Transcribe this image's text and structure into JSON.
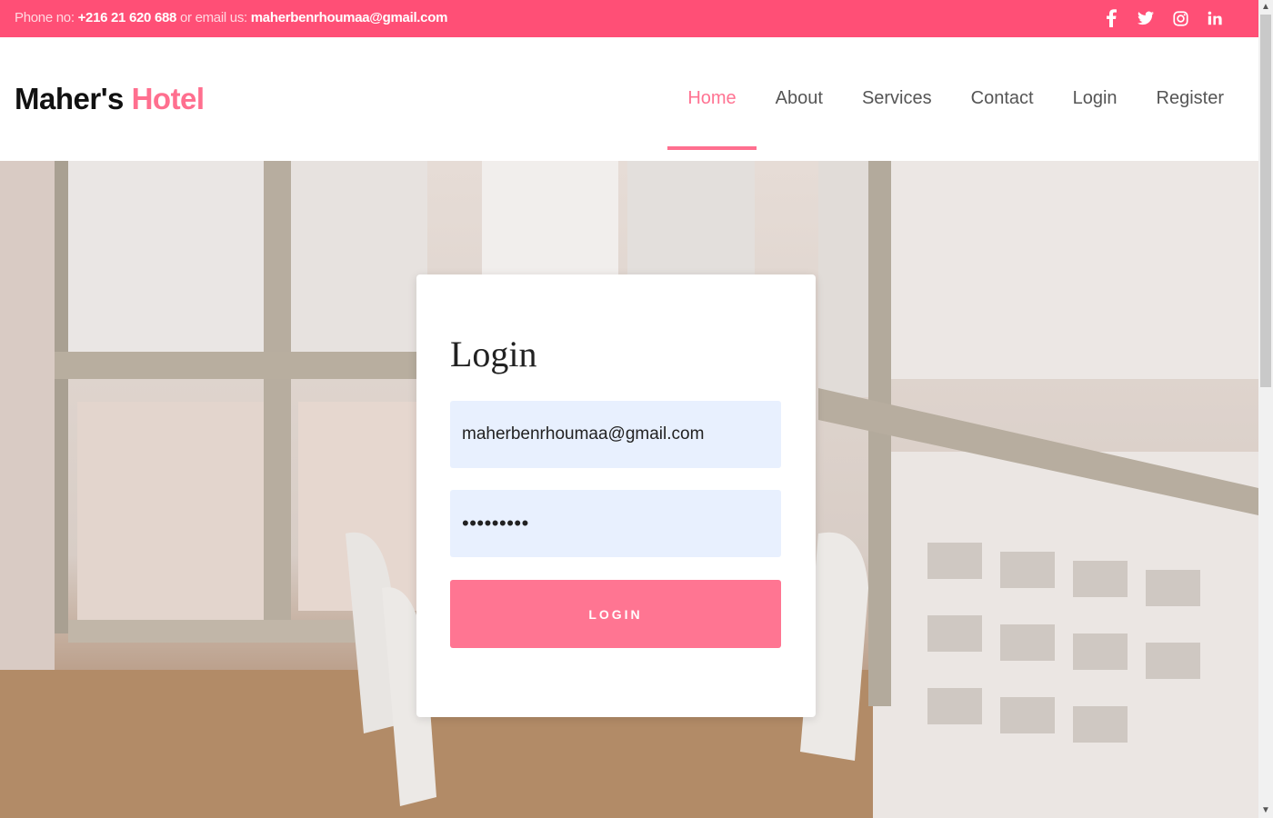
{
  "topbar": {
    "phone_label": "Phone no: ",
    "phone_value": "+216 21 620 688",
    "email_label": " or email us: ",
    "email_value": "maherbenrhoumaa@gmail.com",
    "social": [
      "facebook-icon",
      "twitter-icon",
      "instagram-icon",
      "linkedin-icon"
    ]
  },
  "logo": {
    "part1": "Maher's ",
    "part2": "Hotel"
  },
  "nav": {
    "home": "Home",
    "about": "About",
    "services": "Services",
    "contact": "Contact",
    "login": "Login",
    "register": "Register",
    "active": "Home"
  },
  "login_card": {
    "title": "Login",
    "email_value": "maherbenrhoumaa@gmail.com",
    "password_value": "•••••••••",
    "button_label": "LOGIN"
  },
  "colors": {
    "brand": "#ff4f76",
    "accent": "#ff7592",
    "input_bg": "#e8f0fe"
  }
}
